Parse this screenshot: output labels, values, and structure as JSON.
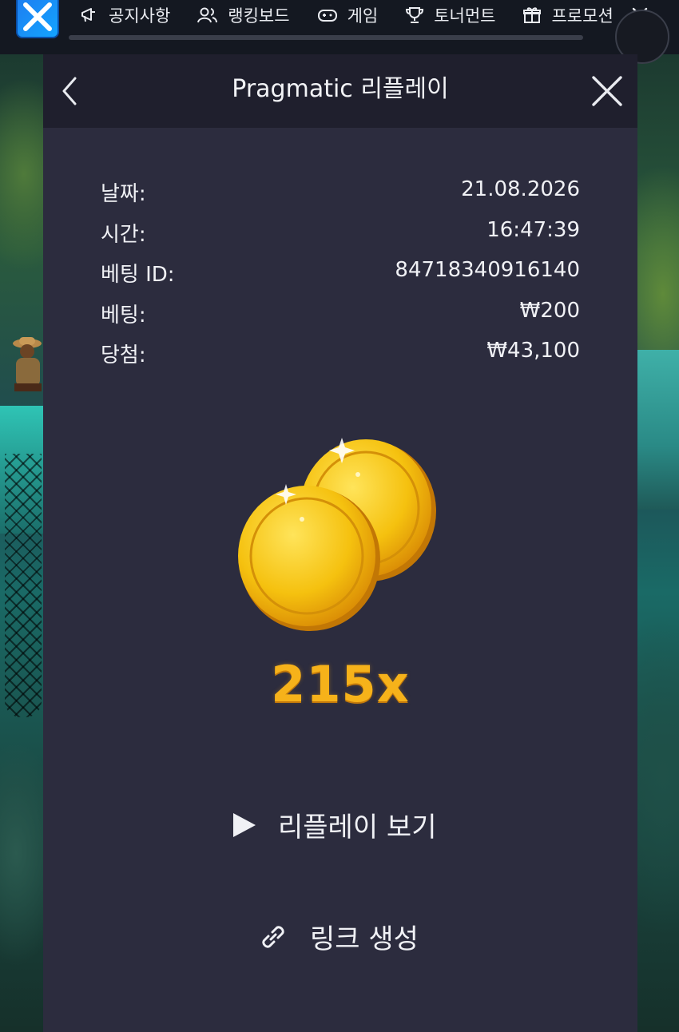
{
  "nav": {
    "items": [
      {
        "label": "공지사항",
        "icon": "megaphone-icon"
      },
      {
        "label": "랭킹보드",
        "icon": "users-icon"
      },
      {
        "label": "게임",
        "icon": "gamepad-icon"
      },
      {
        "label": "토너먼트",
        "icon": "trophy-icon"
      },
      {
        "label": "프로모션",
        "icon": "gift-icon"
      }
    ]
  },
  "modal": {
    "title": "Pragmatic 리플레이",
    "details": [
      {
        "label": "날짜:",
        "value": "21.08.2026"
      },
      {
        "label": "시간:",
        "value": "16:47:39"
      },
      {
        "label": "베팅 ID:",
        "value": "84718340916140"
      },
      {
        "label": "베팅:",
        "value": "₩200"
      },
      {
        "label": "당첨:",
        "value": "₩43,100"
      }
    ],
    "multiplier": "215x",
    "replay_label": "리플레이 보기",
    "link_label": "링크 생성"
  },
  "colors": {
    "modal_bg": "#2c2c3e",
    "header_bg": "#1f1f2d",
    "multiplier": "#f6b21a"
  }
}
